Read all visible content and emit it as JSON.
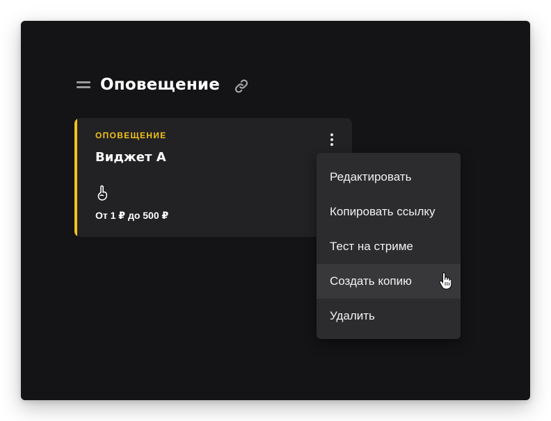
{
  "section": {
    "title": "Оповещение",
    "handle_icon": "drag-handle-icon",
    "link_icon": "link-icon"
  },
  "card": {
    "type_label": "ОПОВЕЩЕНИЕ",
    "title": "Виджет А",
    "emoji_icon": "hand-pointing-up-icon",
    "range": "От 1 ₽ до 500 ₽",
    "accent_color": "#f2c21a",
    "menu_icon": "more-vertical-icon"
  },
  "menu": {
    "items": [
      {
        "label": "Редактировать"
      },
      {
        "label": "Копировать ссылку"
      },
      {
        "label": "Тест на стриме"
      },
      {
        "label": "Создать копию",
        "hovered": true
      },
      {
        "label": "Удалить"
      }
    ]
  },
  "colors": {
    "panel_bg": "#141416",
    "card_bg": "#222224",
    "menu_bg": "#2c2c2f",
    "menu_hover_bg": "#38383b",
    "accent": "#f2c21a"
  }
}
